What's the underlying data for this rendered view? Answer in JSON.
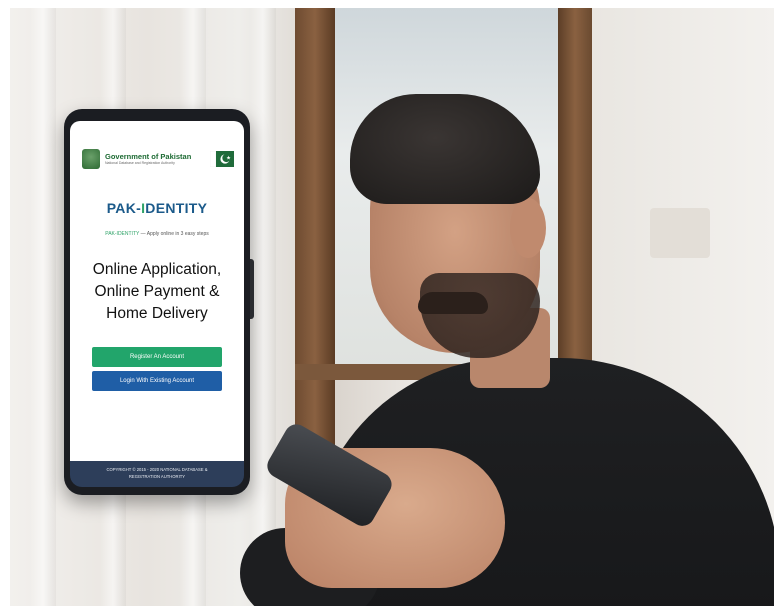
{
  "phone": {
    "gov_title": "Government of Pakistan",
    "gov_subtitle": "National Database and Registration Authority",
    "brand_prefix": "PAK-",
    "brand_accent": "I",
    "brand_suffix": "DENTITY",
    "tagline_brand": "PAK-IDENTITY",
    "tagline_rest": " — Apply online in 3 easy steps",
    "headline": [
      "Online Application,",
      "Online Payment &",
      "Home Delivery"
    ],
    "register_button": "Register An Account",
    "login_button": "Login With Existing Account",
    "footer_line1": "COPYRIGHT © 2015 - 2020 NATIONAL DATABASE &",
    "footer_line2": "REGISTRATION AUTHORITY"
  },
  "colors": {
    "green": "#22a56b",
    "blue": "#1f5ea6",
    "navy": "#2d3e5a",
    "brand_blue": "#1b5a8a"
  }
}
